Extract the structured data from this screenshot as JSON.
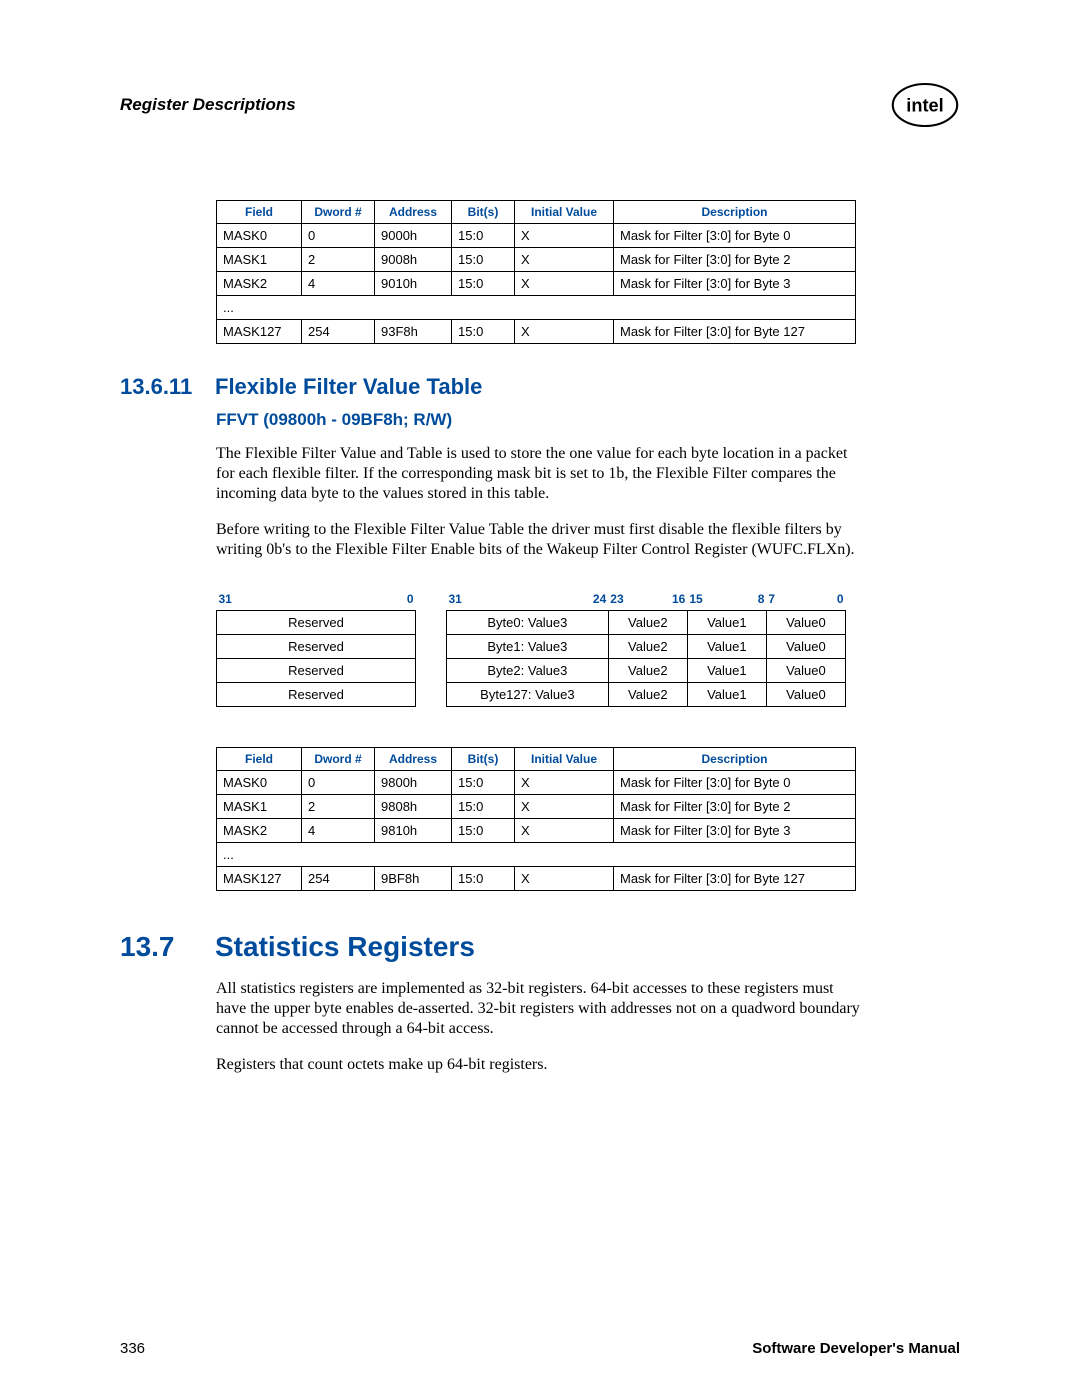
{
  "header": {
    "title": "Register Descriptions"
  },
  "table1": {
    "headers": [
      "Field",
      "Dword #",
      "Address",
      "Bit(s)",
      "Initial Value",
      "Description"
    ],
    "rows": [
      [
        "MASK0",
        "0",
        "9000h",
        "15:0",
        "X",
        "Mask for Filter [3:0] for Byte 0"
      ],
      [
        "MASK1",
        "2",
        "9008h",
        "15:0",
        "X",
        "Mask for Filter [3:0] for Byte 2"
      ],
      [
        "MASK2",
        "4",
        "9010h",
        "15:0",
        "X",
        "Mask for Filter [3:0] for Byte 3"
      ]
    ],
    "dots": "...",
    "lastRow": [
      "MASK127",
      "254",
      "93F8h",
      "15:0",
      "X",
      "Mask for Filter [3:0] for Byte 127"
    ]
  },
  "section_13_6_11": {
    "num": "13.6.11",
    "title": "Flexible Filter Value Table",
    "sub": "FFVT (09800h - 09BF8h; R/W)",
    "p1": "The Flexible Filter Value and Table is used to store the one value for each byte location in a packet for each flexible filter. If the corresponding mask bit is set to 1b, the Flexible Filter compares the incoming data byte to the values stored in this table.",
    "p2": "Before writing to the Flexible Filter Value Table the driver must first disable the flexible filters by writing 0b's to the Flexible Filter Enable bits of the Wakeup Filter Control Register (WUFC.FLXn)."
  },
  "bitLeft": {
    "h31": "31",
    "h0": "0",
    "rows": [
      "Reserved",
      "Reserved",
      "Reserved",
      "Reserved"
    ]
  },
  "bitRight": {
    "headers": [
      "31",
      "24",
      "23",
      "16",
      "15",
      "8",
      "7",
      "0"
    ],
    "rows": [
      [
        "Byte0: Value3",
        "Value2",
        "Value1",
        "Value0"
      ],
      [
        "Byte1: Value3",
        "Value2",
        "Value1",
        "Value0"
      ],
      [
        "Byte2: Value3",
        "Value2",
        "Value1",
        "Value0"
      ],
      [
        "Byte127: Value3",
        "Value2",
        "Value1",
        "Value0"
      ]
    ]
  },
  "table2": {
    "headers": [
      "Field",
      "Dword #",
      "Address",
      "Bit(s)",
      "Initial Value",
      "Description"
    ],
    "rows": [
      [
        "MASK0",
        "0",
        "9800h",
        "15:0",
        "X",
        "Mask for Filter [3:0] for Byte 0"
      ],
      [
        "MASK1",
        "2",
        "9808h",
        "15:0",
        "X",
        "Mask for Filter [3:0] for Byte 2"
      ],
      [
        "MASK2",
        "4",
        "9810h",
        "15:0",
        "X",
        "Mask for Filter [3:0] for Byte 3"
      ]
    ],
    "dots": "...",
    "lastRow": [
      "MASK127",
      "254",
      "9BF8h",
      "15:0",
      "X",
      "Mask for Filter [3:0] for Byte 127"
    ]
  },
  "section_13_7": {
    "num": "13.7",
    "title": "Statistics Registers",
    "p1": "All statistics registers are implemented as 32-bit registers. 64-bit accesses to these registers must have the upper byte enables de-asserted. 32-bit registers with addresses not on a quadword boundary cannot be accessed through a 64-bit access.",
    "p2": "Registers that count octets make up 64-bit registers."
  },
  "footer": {
    "page": "336",
    "title": "Software Developer's Manual"
  }
}
